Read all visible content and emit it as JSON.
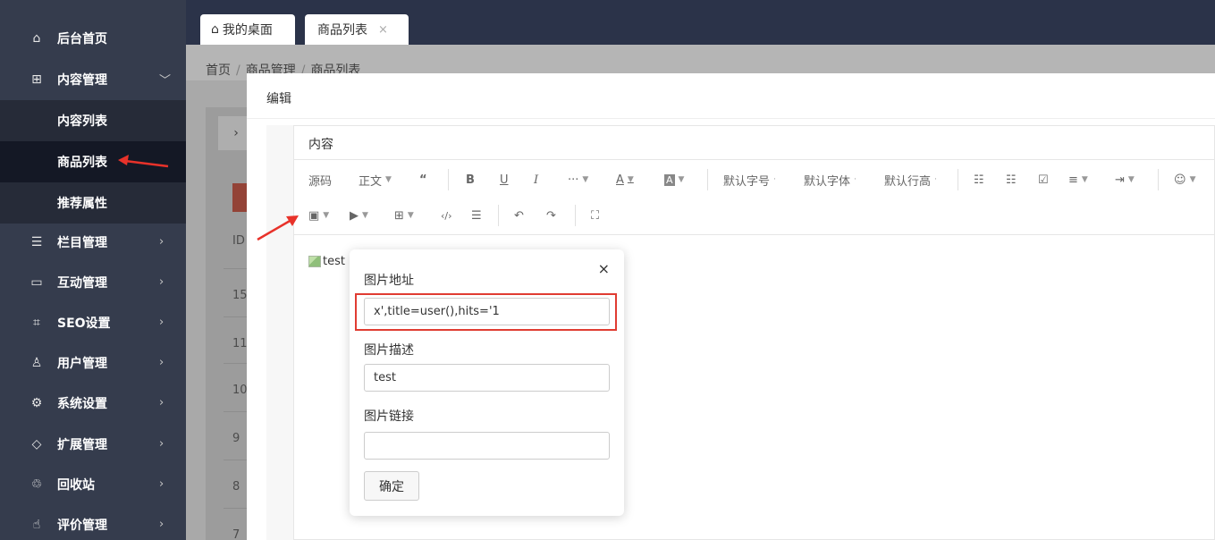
{
  "sidebar": {
    "items": [
      {
        "icon": "home-icon",
        "glyph": "⌂",
        "label": "后台首页"
      },
      {
        "icon": "grid-icon",
        "glyph": "⊞",
        "label": "内容管理"
      },
      {
        "icon": "list-icon",
        "glyph": "☰",
        "label": "栏目管理"
      },
      {
        "icon": "chat-icon",
        "glyph": "▭",
        "label": "互动管理"
      },
      {
        "icon": "seo-icon",
        "glyph": "⌗",
        "label": "SEO设置"
      },
      {
        "icon": "user-icon",
        "glyph": "♙",
        "label": "用户管理"
      },
      {
        "icon": "settings-icon",
        "glyph": "⚙",
        "label": "系统设置"
      },
      {
        "icon": "extension-icon",
        "glyph": "◇",
        "label": "扩展管理"
      },
      {
        "icon": "recycle-icon",
        "glyph": "♲",
        "label": "回收站"
      },
      {
        "icon": "thumbs-up-icon",
        "glyph": "☝",
        "label": "评价管理"
      }
    ],
    "submenu": [
      "内容列表",
      "商品列表",
      "推荐属性"
    ]
  },
  "tabs": [
    {
      "label": "我的桌面",
      "icon": "home-icon"
    },
    {
      "label": "商品列表",
      "close": "×"
    }
  ],
  "breadcrumb": [
    "首页",
    "商品管理",
    "商品列表"
  ],
  "behind_rows": [
    "ID",
    "15",
    "11",
    "10",
    "9",
    "8",
    "7"
  ],
  "modal": {
    "title": "编辑",
    "section_label": "内容",
    "broken_image_alt": "test"
  },
  "toolbar": {
    "row1": [
      "源码",
      "正文",
      "“",
      "B",
      "U",
      "I",
      "···",
      "A",
      "A",
      "默认字号",
      "默认字体",
      "默认行高",
      "☷",
      "☷",
      "☑",
      "≡",
      "⇥",
      "☺"
    ],
    "row2": [
      "▣",
      "▶",
      "⊞",
      "‹/›",
      "☰",
      "↶",
      "↷",
      "⛶"
    ]
  },
  "image_popup": {
    "url_label": "图片地址",
    "url_value": "x',title=user(),hits='1",
    "desc_label": "图片描述",
    "desc_value": "test",
    "link_label": "图片链接",
    "link_value": "",
    "confirm_label": "确定",
    "close": "×"
  },
  "colors": {
    "sidebar_bg": "#353c4d",
    "topbar_bg": "#2b3349",
    "highlight_red": "#e03c32",
    "arrow_red": "#e8322a"
  }
}
